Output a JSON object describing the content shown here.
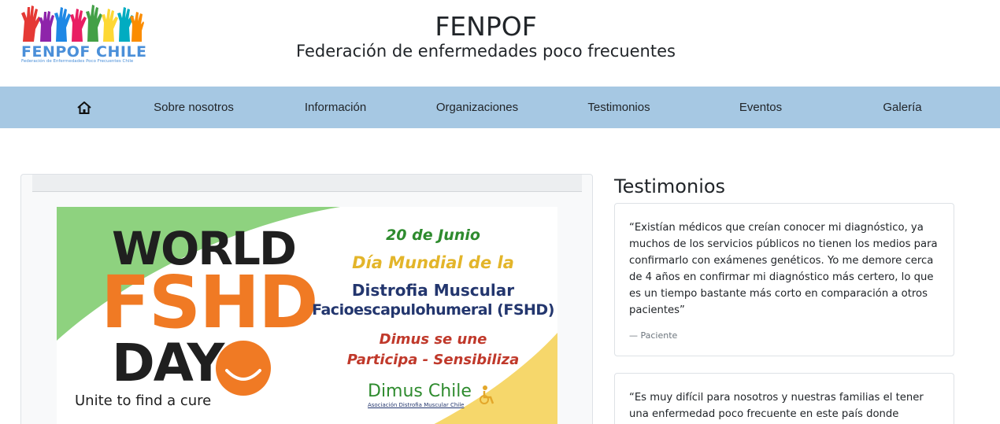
{
  "header": {
    "logo_text": "FENPOF CHILE",
    "logo_subtext": "Federación de Enfermedades Poco Frecuentes Chile",
    "title": "FENPOF",
    "subtitle": "Federación de enfermedades poco frecuentes"
  },
  "nav": {
    "home_icon": "home-icon",
    "items": [
      {
        "label": "Sobre nosotros"
      },
      {
        "label": "Información"
      },
      {
        "label": "Organizaciones"
      },
      {
        "label": "Testimonios"
      },
      {
        "label": "Eventos"
      },
      {
        "label": "Galería"
      }
    ],
    "background": "#a6c8e3"
  },
  "banner": {
    "world": "WORLD",
    "fshd": "FSHD",
    "day": "DAY",
    "tagline": "Unite to find a cure",
    "date": "20 de Junio",
    "line1": "Día Mundial de la",
    "line2": "Distrofia Muscular",
    "line3": "Facioescapulohumeral (FSHD)",
    "line4": "Dimus se une",
    "line5": "Participa - Sensibiliza",
    "org_name": "Dimus Chile",
    "org_sub": "Asociación Distrofia Muscular Chile",
    "colors": {
      "green": "#8ed27f",
      "yellow": "#f6d76b",
      "orange": "#f07a24",
      "dark": "#1f1f1f"
    }
  },
  "sidebar": {
    "heading": "Testimonios",
    "testimonials": [
      {
        "text": "“Existían médicos que creían conocer mi diagnóstico, ya muchos de los servicios públicos no tienen los medios para confirmarlo con exámenes genéticos. Yo me demore cerca de 4 años en confirmar mi diagnóstico más certero, lo que es un tiempo bastante más corto en comparación a otros pacientes”",
        "author": "— Paciente"
      },
      {
        "text": "“Es muy difícil para nosotros y nuestras familias el tener una enfermedad poco frecuente en este país donde muchas veces",
        "author": ""
      }
    ]
  }
}
